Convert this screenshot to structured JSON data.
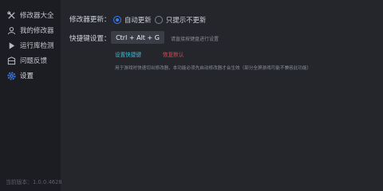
{
  "sidebar": {
    "items": [
      {
        "label": "修改器大全",
        "icon": "wrench-icon"
      },
      {
        "label": "我的修改器",
        "icon": "user-icon"
      },
      {
        "label": "运行库检测",
        "icon": "play-icon"
      },
      {
        "label": "问题反馈",
        "icon": "feedback-icon"
      },
      {
        "label": "设置",
        "icon": "gear-icon",
        "active": true
      }
    ],
    "version": "当前版本：1.0.0.4628"
  },
  "settings": {
    "update_label": "修改器更新：",
    "update_options": [
      {
        "label": "自动更新",
        "checked": true
      },
      {
        "label": "只提示不更新",
        "checked": false
      }
    ],
    "hotkey_label": "快捷键设置：",
    "hotkey_value": "Ctrl + Alt + G",
    "hotkey_hint": "请直接按键盘进行设置",
    "set_hotkey_link": "设置快捷键",
    "restore_default_link": "恢复默认",
    "description": "用于游戏时快速切出修改器，本功能必须先启动修改器才会生效（部分全屏游戏可能不兼容此功能）"
  },
  "colors": {
    "accent": "#3a7df0",
    "link_cyan": "#2ec4dd",
    "link_red": "#e0474c",
    "sidebar_bg": "#1b1d22",
    "main_bg": "#24262c"
  }
}
